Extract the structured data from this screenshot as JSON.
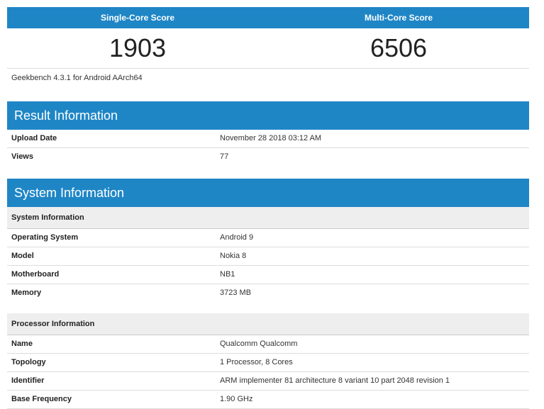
{
  "scores": {
    "single_label": "Single-Core Score",
    "multi_label": "Multi-Core Score",
    "single_value": "1903",
    "multi_value": "6506"
  },
  "benchmark_version": "Geekbench 4.3.1 for Android AArch64",
  "result_info": {
    "title": "Result Information",
    "rows": [
      {
        "label": "Upload Date",
        "value": "November 28 2018 03:12 AM"
      },
      {
        "label": "Views",
        "value": "77"
      }
    ]
  },
  "system_info": {
    "title": "System Information",
    "system_group": {
      "heading": "System Information",
      "rows": [
        {
          "label": "Operating System",
          "value": "Android 9"
        },
        {
          "label": "Model",
          "value": "Nokia 8"
        },
        {
          "label": "Motherboard",
          "value": "NB1"
        },
        {
          "label": "Memory",
          "value": "3723 MB"
        }
      ]
    },
    "processor_group": {
      "heading": "Processor Information",
      "rows": [
        {
          "label": "Name",
          "value": "Qualcomm Qualcomm"
        },
        {
          "label": "Topology",
          "value": "1 Processor, 8 Cores"
        },
        {
          "label": "Identifier",
          "value": "ARM implementer 81 architecture 8 variant 10 part 2048 revision 1"
        },
        {
          "label": "Base Frequency",
          "value": "1.90 GHz"
        }
      ]
    }
  }
}
